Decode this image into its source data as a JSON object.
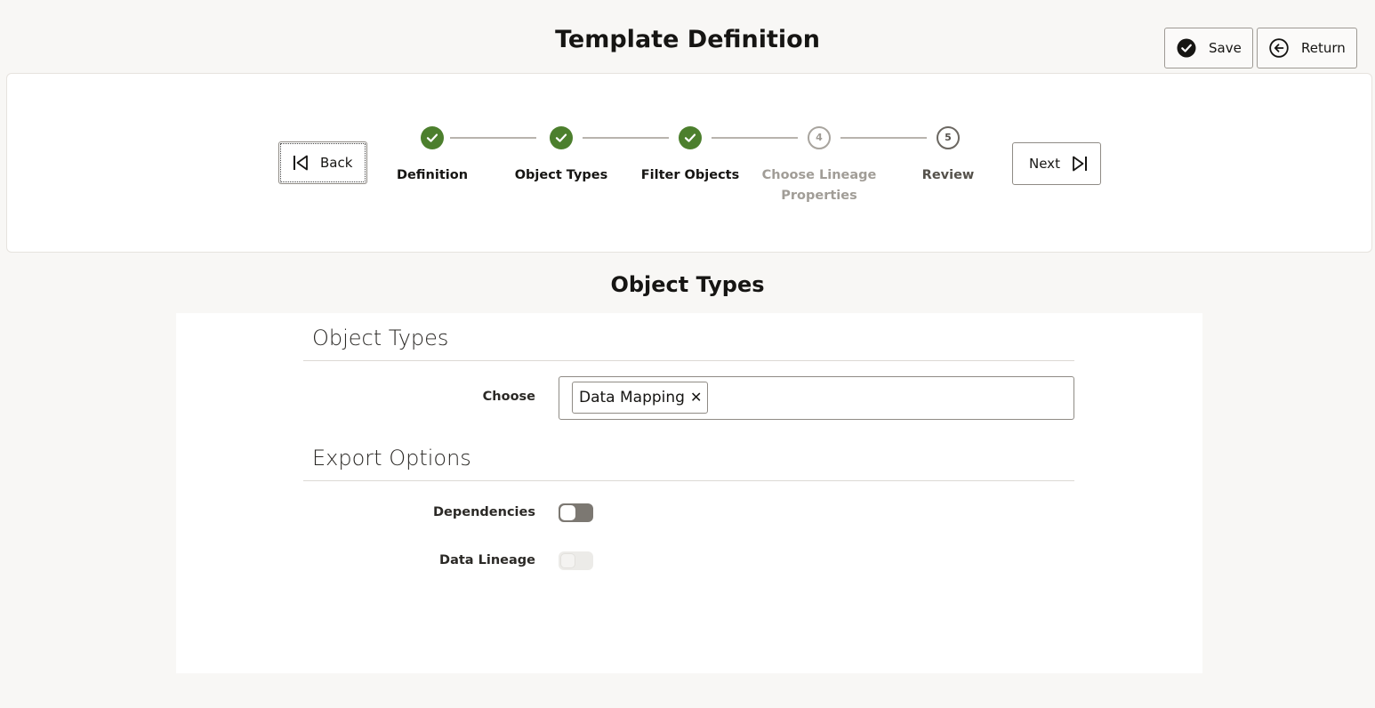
{
  "header": {
    "title": "Template Definition",
    "save_label": "Save",
    "return_label": "Return"
  },
  "train": {
    "back_label": "Back",
    "next_label": "Next",
    "steps": [
      {
        "label": "Definition",
        "state": "completed"
      },
      {
        "label": "Object Types",
        "state": "completed"
      },
      {
        "label": "Filter Objects",
        "state": "completed"
      },
      {
        "label": "Choose Lineage Properties",
        "state": "disabled",
        "number": "4"
      },
      {
        "label": "Review",
        "state": "pending",
        "number": "5"
      }
    ]
  },
  "section": {
    "heading": "Object Types",
    "object_types_group": {
      "title": "Object Types",
      "choose_label": "Choose",
      "selected_chips": [
        "Data Mapping"
      ]
    },
    "export_options_group": {
      "title": "Export Options",
      "dependencies_label": "Dependencies",
      "dependencies_value": false,
      "data_lineage_label": "Data Lineage",
      "data_lineage_value": false,
      "data_lineage_disabled": true
    }
  },
  "colors": {
    "completed_step": "#4c7f2d",
    "page_background": "#f8f7f5"
  }
}
